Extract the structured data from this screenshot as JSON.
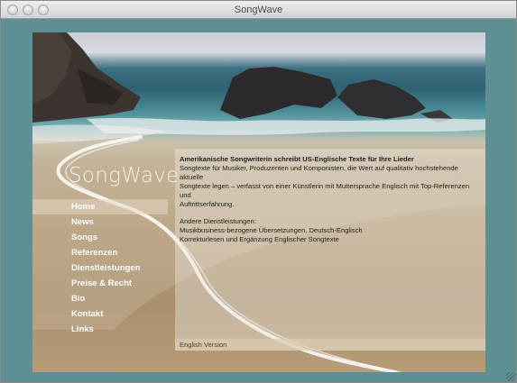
{
  "window": {
    "title": "SongWave"
  },
  "site": {
    "logo": "SongWave",
    "nav": [
      {
        "label": "Home",
        "active": true
      },
      {
        "label": "News"
      },
      {
        "label": "Songs"
      },
      {
        "label": "Referenzen"
      },
      {
        "label": "Dienstleistungen"
      },
      {
        "label": "Preise & Recht"
      },
      {
        "label": "Bio"
      },
      {
        "label": "Kontakt"
      },
      {
        "label": "Links"
      }
    ],
    "content": {
      "heading": "Amerikanische Songwriterin schreibt US-Englische Texte für Ihre Lieder",
      "intro_line1": "Songtexte für Musiker, Produzenten und Komponisten, die Wert auf qualitativ hochstehende aktuelle",
      "intro_line2": "Songtexte legen – verfasst von einer Künstlerin mit Muttersprache Englisch mit Top-Referenzen und",
      "intro_line3": "Auftrittserfahrung.",
      "services_title": "Andere Dienstleistungen:",
      "service1": "Musikbusiness-bezogene Übersetzungen, Deutsch-Englisch",
      "service2": "Korrekturlesen und Ergänzung Englischer Songtexte"
    },
    "footer_link": "English Version"
  }
}
